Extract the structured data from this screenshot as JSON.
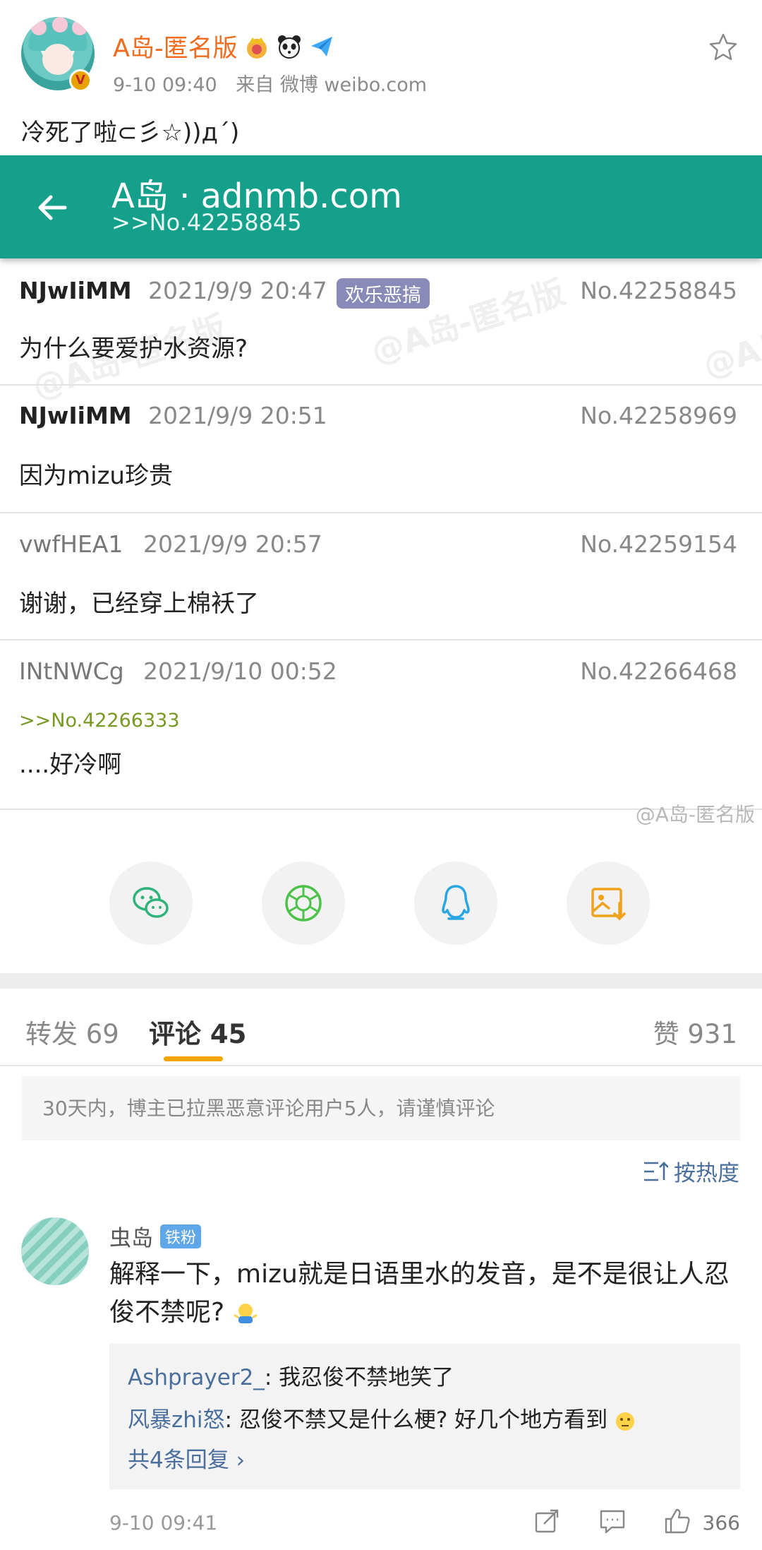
{
  "post": {
    "author": "A岛-匿名版",
    "time": "9-10 09:40",
    "source": "来自 微博 weibo.com",
    "text": "冷死了啦⊂彡☆))д´)"
  },
  "embed": {
    "appbar": {
      "title": "A岛 · adnmb.com",
      "subtitle": ">>No.42258845"
    },
    "watermark": "@A岛-匿名版",
    "image_watermark": "@A岛-匿名版",
    "replies": [
      {
        "uid": "NJwIiMM",
        "time": "2021/9/9 20:47",
        "tag": "欢乐恶搞",
        "no": "No.42258845",
        "body": "为什么要爱护水资源?"
      },
      {
        "uid": "NJwIiMM",
        "time": "2021/9/9 20:51",
        "no": "No.42258969",
        "body": "因为mizu珍贵"
      },
      {
        "uid": "vwfHEA1",
        "time": "2021/9/9 20:57",
        "no": "No.42259154",
        "body": "谢谢，已经穿上棉袄了"
      },
      {
        "uid": "INtNWCg",
        "time": "2021/9/10 00:52",
        "no": "No.42266468",
        "quote": ">>No.42266333",
        "body": "....好冷啊"
      }
    ]
  },
  "tabs": {
    "repost": "转发 69",
    "comments": "评论 45",
    "likes": "赞 931"
  },
  "notice": "30天内，博主已拉黑恶意评论用户5人，请谨慎评论",
  "sort_label": "按热度",
  "comment": {
    "name": "虫岛",
    "badge": "铁粉",
    "text": "解释一下，mizu就是日语里水的发音，是不是很让人忍俊不禁呢?",
    "replies": [
      {
        "who": "Ashprayer2_",
        "text": ": 我忍俊不禁地笑了"
      },
      {
        "who": "风暴zhi怒",
        "text": ": 忍俊不禁又是什么梗? 好几个地方看到"
      }
    ],
    "more": "共4条回复",
    "time": "9-10 09:41",
    "likes": "366"
  },
  "colors": {
    "author": "#f26c1f",
    "appbar": "#14a08a",
    "link": "#4a6f9c",
    "tab_accent": "#f5a500",
    "quote": "#789922"
  }
}
